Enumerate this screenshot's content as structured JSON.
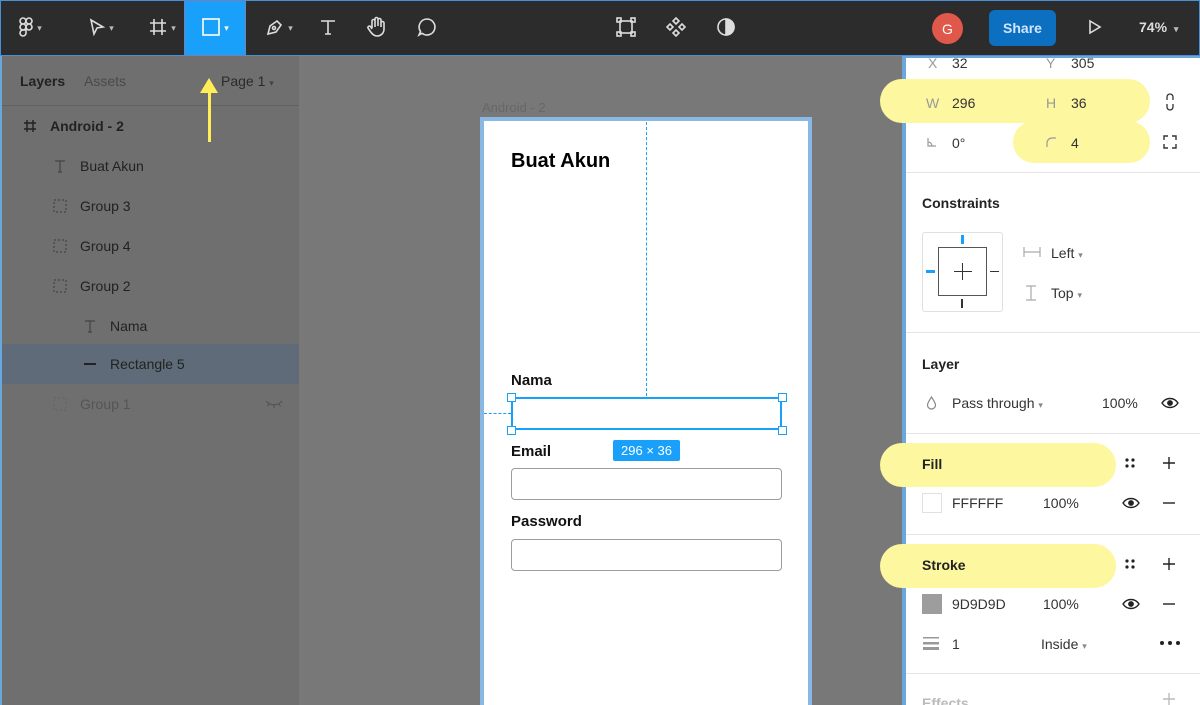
{
  "toolbar": {
    "tools": [
      {
        "name": "main-menu",
        "icon": "figma-logo-icon"
      },
      {
        "name": "move-tool",
        "icon": "cursor-arrow-icon"
      },
      {
        "name": "frame-tool",
        "icon": "frame-hash-icon"
      },
      {
        "name": "shape-tool",
        "icon": "rectangle-icon",
        "active": true
      },
      {
        "name": "pen-tool",
        "icon": "pen-icon"
      },
      {
        "name": "text-tool",
        "icon": "text-icon"
      },
      {
        "name": "hand-tool",
        "icon": "hand-icon"
      },
      {
        "name": "comment-tool",
        "icon": "comment-icon"
      }
    ],
    "center_tools": [
      "component-bounds-icon",
      "components-icon",
      "contrast-icon"
    ],
    "avatar_initial": "G",
    "share_label": "Share",
    "play_icon": "play-icon",
    "zoom_label": "74%",
    "accent_color": "#18a0fb"
  },
  "left_panel": {
    "tab_layers": "Layers",
    "tab_assets": "Assets",
    "page_label": "Page 1",
    "layers": [
      {
        "label": "Android - 2",
        "icon": "frame-hash-icon"
      },
      {
        "label": "Buat Akun",
        "icon": "text-icon"
      },
      {
        "label": "Group 3",
        "icon": "group-dashed-icon"
      },
      {
        "label": "Group 4",
        "icon": "group-dashed-icon"
      },
      {
        "label": "Group 2",
        "icon": "group-dashed-icon"
      },
      {
        "label": "Nama",
        "icon": "text-icon"
      },
      {
        "label": "Rectangle 5",
        "icon": "rectangle-line-icon",
        "selected": true
      },
      {
        "label": "Group 1",
        "icon": "group-dashed-icon",
        "hidden": true
      }
    ]
  },
  "canvas": {
    "frame_label": "Android - 2",
    "title": "Buat Akun",
    "labels": [
      "Nama",
      "Email",
      "Password"
    ],
    "size_badge": "296 × 36"
  },
  "right_panel": {
    "x_label": "X",
    "x_value": "32",
    "y_label": "Y",
    "y_value": "305",
    "w_label": "W",
    "w_value": "296",
    "h_label": "H",
    "h_value": "36",
    "rotation_value": "0°",
    "radius_value": "4",
    "constraints_title": "Constraints",
    "constraint_h": "Left",
    "constraint_v": "Top",
    "layer_title": "Layer",
    "blend_mode": "Pass through",
    "layer_opacity": "100%",
    "fill_title": "Fill",
    "fill_hex": "FFFFFF",
    "fill_opacity": "100%",
    "fill_color": "#FFFFFF",
    "stroke_title": "Stroke",
    "stroke_hex": "9D9D9D",
    "stroke_opacity": "100%",
    "stroke_color": "#9D9D9D",
    "stroke_weight": "1",
    "stroke_position": "Inside",
    "effects_title": "Effects",
    "highlight_color": "#fdf7a0"
  }
}
